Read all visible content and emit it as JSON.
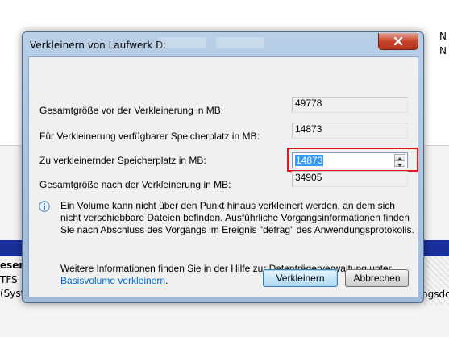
{
  "background": {
    "right_top_letters": [
      "N",
      "N"
    ],
    "left_volume_lines": [
      "eserv",
      "TFS",
      "(Syst"
    ],
    "right_volume_fragment": "ngsdc"
  },
  "dialog": {
    "title": "Verkleinern von Laufwerk D:",
    "rows": [
      {
        "label": "Gesamtgröße vor der Verkleinerung in MB:",
        "value": "49778"
      },
      {
        "label": "Für Verkleinerung verfügbarer Speicherplatz in MB:",
        "value": "14873"
      },
      {
        "label": "Zu verkleinernder Speicherplatz in MB:",
        "value": "14873"
      },
      {
        "label": "Gesamtgröße nach der Verkleinerung in MB:",
        "value": "34905"
      }
    ],
    "info_text": "Ein Volume kann nicht über den Punkt hinaus verkleinert werden, an dem sich nicht verschiebbare Dateien befinden. Ausführliche Vorgangsinformationen finden Sie nach Abschluss des Vorgangs im Ereignis \"defrag\" des Anwendungsprotokolls.",
    "more_text": "Weitere Informationen finden Sie in der Hilfe zur Datenträgerverwaltung unter",
    "more_link": "Basisvolume verkleinern",
    "more_suffix": ".",
    "buttons": {
      "shrink": "Verkleinern",
      "cancel": "Abbrechen"
    }
  },
  "icons": [
    "close-icon",
    "info-icon",
    "spin-up-icon",
    "spin-down-icon"
  ],
  "colors": {
    "highlight_border": "#e0151b",
    "selection": "#3399ff",
    "link": "#0066cc",
    "close_button": "#c8452c"
  }
}
